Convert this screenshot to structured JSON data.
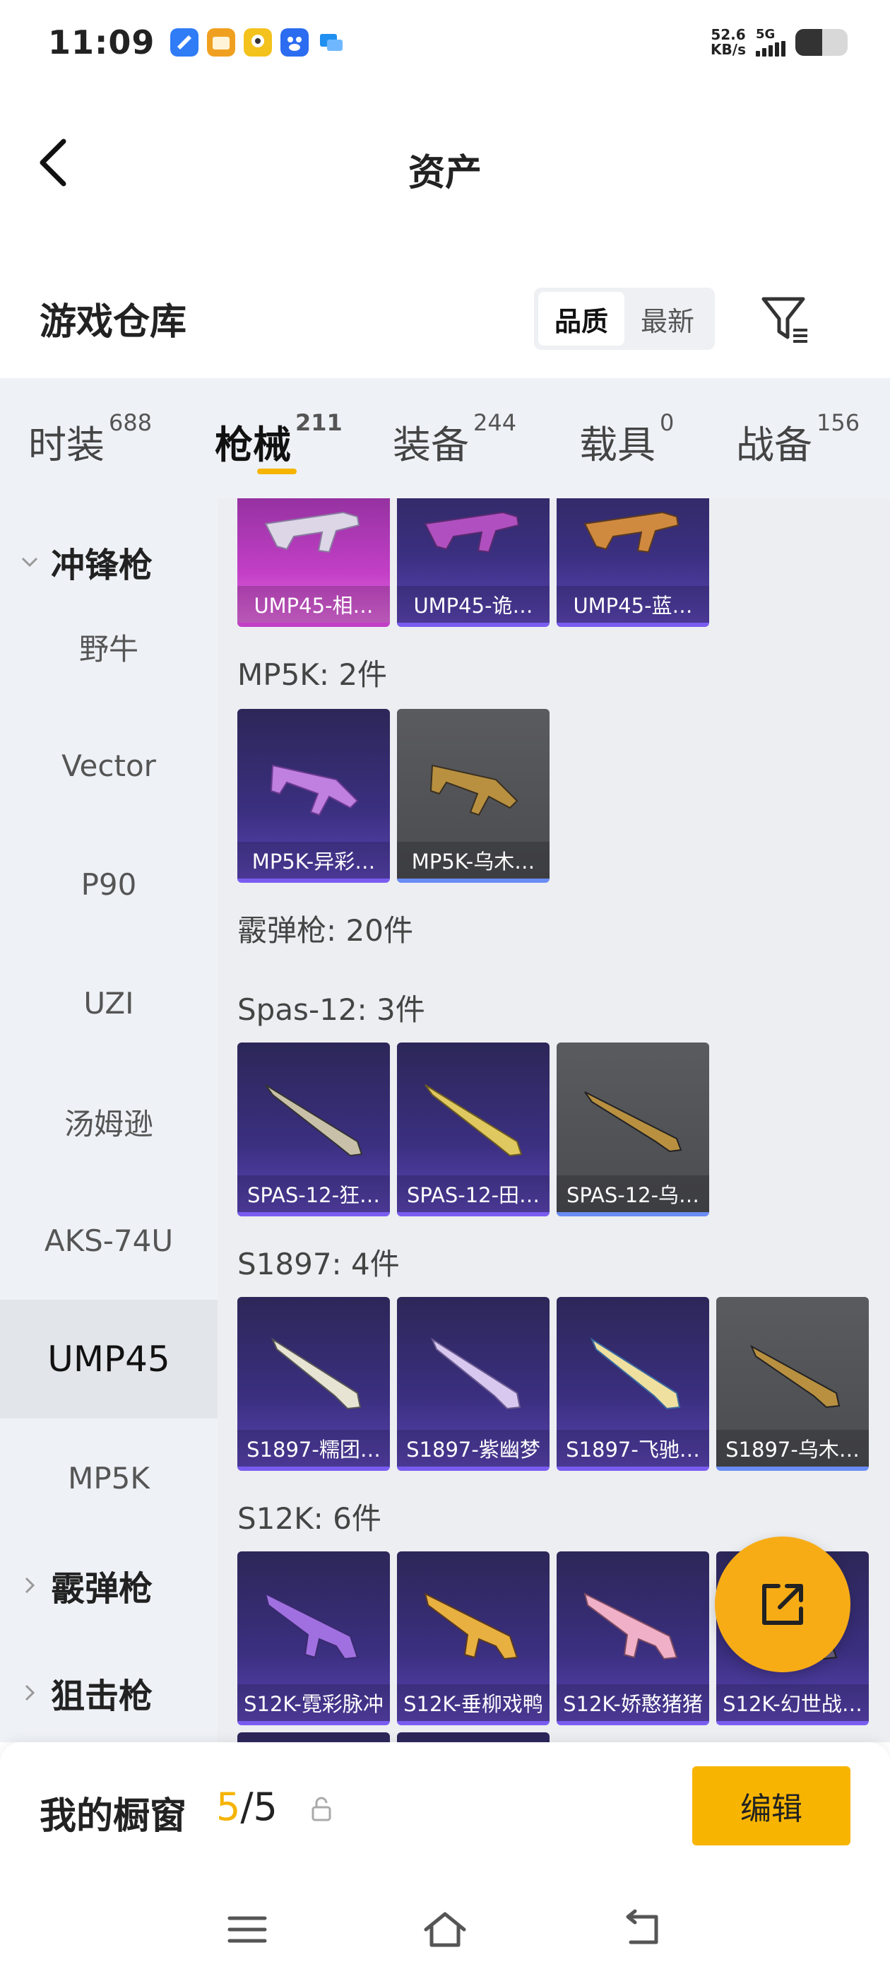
{
  "status_bar": {
    "time": "11:09",
    "net_speed_value": "52.6",
    "net_speed_unit": "KB/s",
    "network": "5G",
    "apps": [
      {
        "icon": "browser-app-icon",
        "color": "#2f7cf6"
      },
      {
        "icon": "shopping-app-icon",
        "color": "#f0a020"
      },
      {
        "icon": "video-app-icon",
        "color": "#f4c21c"
      },
      {
        "icon": "baidu-app-icon",
        "color": "#2b6cf0"
      },
      {
        "icon": "message-app-icon",
        "color": "#1f8ff0"
      }
    ]
  },
  "nav": {
    "title": "资产",
    "back_icon": "back-arrow-icon"
  },
  "header": {
    "section_title": "游戏仓库",
    "sort_options": [
      "品质",
      "最新"
    ],
    "sort_selected": "品质",
    "filter_icon": "filter-list-icon"
  },
  "category_tabs": [
    {
      "label": "时装",
      "count": "688"
    },
    {
      "label": "枪械",
      "count": "211",
      "active": true
    },
    {
      "label": "装备",
      "count": "244"
    },
    {
      "label": "载具",
      "count": "0"
    },
    {
      "label": "战备",
      "count": "156"
    }
  ],
  "sidebar": {
    "group_smg": "冲锋枪",
    "items": [
      "野牛",
      "Vector",
      "P90",
      "UZI",
      "汤姆逊",
      "AKS-74U",
      "UMP45",
      "MP5K"
    ],
    "active_item": "UMP45",
    "group_shotgun": "霰弹枪",
    "group_partial": "狙击枪"
  },
  "content": {
    "top_row": [
      "UMP45-相…",
      "UMP45-诡…",
      "UMP45-蓝…"
    ],
    "mp5k_head": "MP5K: 2件",
    "mp5k_items": [
      "MP5K-异彩…",
      "MP5K-乌木…"
    ],
    "shotgun_head": "霰弹枪: 20件",
    "spas_head": "Spas-12: 3件",
    "spas_items": [
      "SPAS-12-狂…",
      "SPAS-12-田…",
      "SPAS-12-乌…"
    ],
    "s1897_head": "S1897: 4件",
    "s1897_items": [
      "S1897-糯团…",
      "S1897-紫幽梦",
      "S1897-飞驰…",
      "S1897-乌木…"
    ],
    "s12k_head": "S12K: 6件",
    "s12k_items": [
      "S12K-霓彩脉冲",
      "S12K-垂柳戏鸭",
      "S12K-娇憨猪猪",
      "S12K-幻世战…"
    ]
  },
  "fab_icon": "share-external-icon",
  "bottom_bar": {
    "window_label": "我的橱窗",
    "count_current": "5",
    "count_total": "/5",
    "lock_icon": "lock-open-icon",
    "edit_label": "编辑"
  },
  "system_nav": {
    "menu_icon": "menu-icon",
    "home_icon": "home-icon",
    "back_icon": "back-icon"
  },
  "colors": {
    "accent": "#f5b400",
    "card_purple": "#3b2f80",
    "card_pink": "#c23fc6",
    "card_grey": "#4b4c50",
    "sidebar_bg": "#eef1f6"
  }
}
